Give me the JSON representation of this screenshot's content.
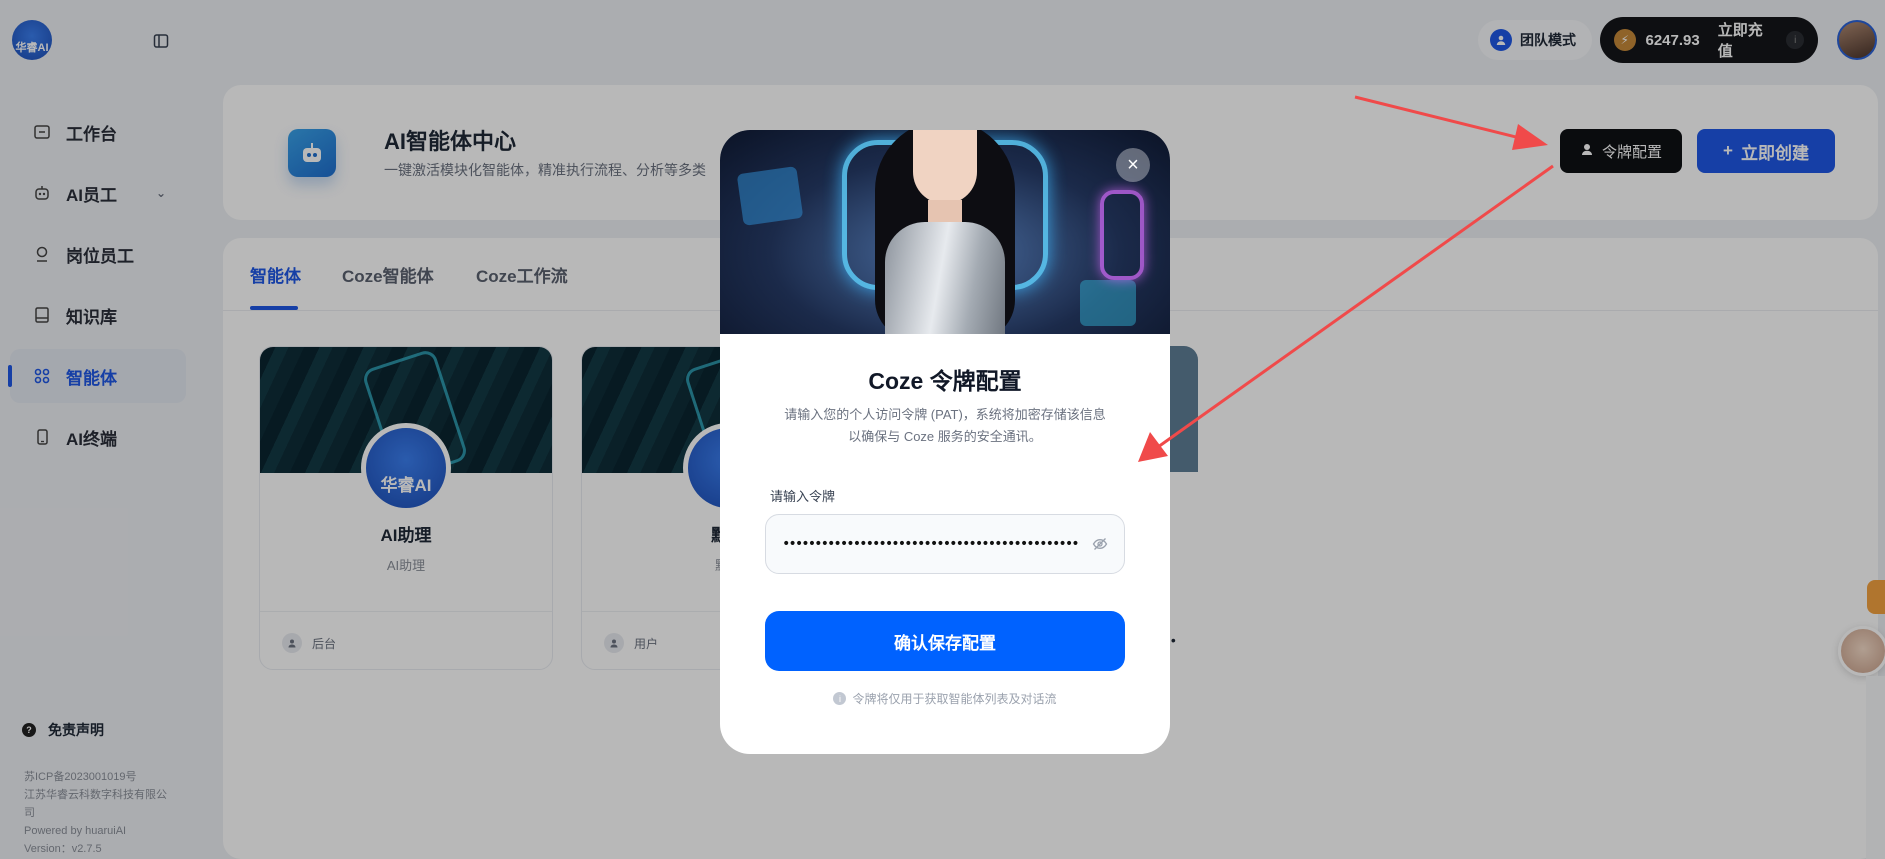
{
  "app": {
    "logo_text": "华睿AI"
  },
  "topbar": {
    "team_mode_label": "团队模式",
    "balance": "6247.93",
    "recharge_label": "立即充值"
  },
  "sidebar": {
    "items": [
      {
        "label": "工作台",
        "icon": "workbench-icon"
      },
      {
        "label": "AI员工",
        "icon": "robot-icon"
      },
      {
        "label": "岗位员工",
        "icon": "person-icon"
      },
      {
        "label": "知识库",
        "icon": "book-icon"
      },
      {
        "label": "智能体",
        "icon": "apps-icon"
      },
      {
        "label": "AI终端",
        "icon": "phone-icon"
      }
    ],
    "active_index": 4,
    "disclaimer_label": "免责声明",
    "footer": {
      "icp": "苏ICP备2023001019号",
      "company": "江苏华睿云科数字科技有限公司",
      "powered": "Powered by huaruiAI",
      "version": "Version：v2.7.5"
    }
  },
  "hero": {
    "title": "AI智能体中心",
    "subtitle": "一键激活模块化智能体，精准执行流程、分析等多类",
    "token_button": "令牌配置",
    "create_button": "立即创建"
  },
  "tabs": [
    {
      "label": "智能体",
      "active": true
    },
    {
      "label": "Coze智能体",
      "active": false
    },
    {
      "label": "Coze工作流",
      "active": false
    }
  ],
  "cards": [
    {
      "name": "AI助理",
      "desc": "AI助理",
      "role": "后台",
      "avatar_text": "华睿AI"
    },
    {
      "name": "默认",
      "desc": "默认",
      "role": "用户",
      "avatar_text": ""
    }
  ],
  "modal": {
    "title": "Coze 令牌配置",
    "desc_line1": "请输入您的个人访问令牌 (PAT)，系统将加密存储该信息",
    "desc_line2": "以确保与 Coze 服务的安全通讯。",
    "field_label": "请输入令牌",
    "token_value": "••••••••••••••••••••••••••••••••••••••••••••••••••••••",
    "save_button": "确认保存配置",
    "hint": "令牌将仅用于获取智能体列表及对话流"
  },
  "colors": {
    "accent": "#1f58e6",
    "primary_button": "#0062ff",
    "arrow": "#f04a4a"
  }
}
